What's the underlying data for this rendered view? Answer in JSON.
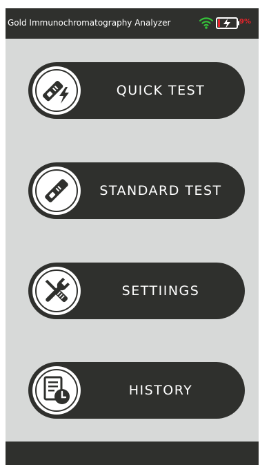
{
  "status_bar": {
    "title": "Gold Immunochromatography Analyzer",
    "wifi_icon": "wifi-icon",
    "battery_icon": "battery-charging-icon",
    "battery_percent": "9%",
    "battery_color": "#e8232a"
  },
  "menu": {
    "quick_test": {
      "label": "QUICK TEST",
      "icon": "test-strip-lightning-icon"
    },
    "standard_test": {
      "label": "STANDARD TEST",
      "icon": "test-strip-icon"
    },
    "settings": {
      "label": "SETTIINGS",
      "icon": "tools-icon"
    },
    "history": {
      "label": "HISTORY",
      "icon": "document-clock-icon"
    }
  },
  "colors": {
    "background": "#d7d9d8",
    "dark": "#2f302d",
    "text": "#ffffff"
  }
}
